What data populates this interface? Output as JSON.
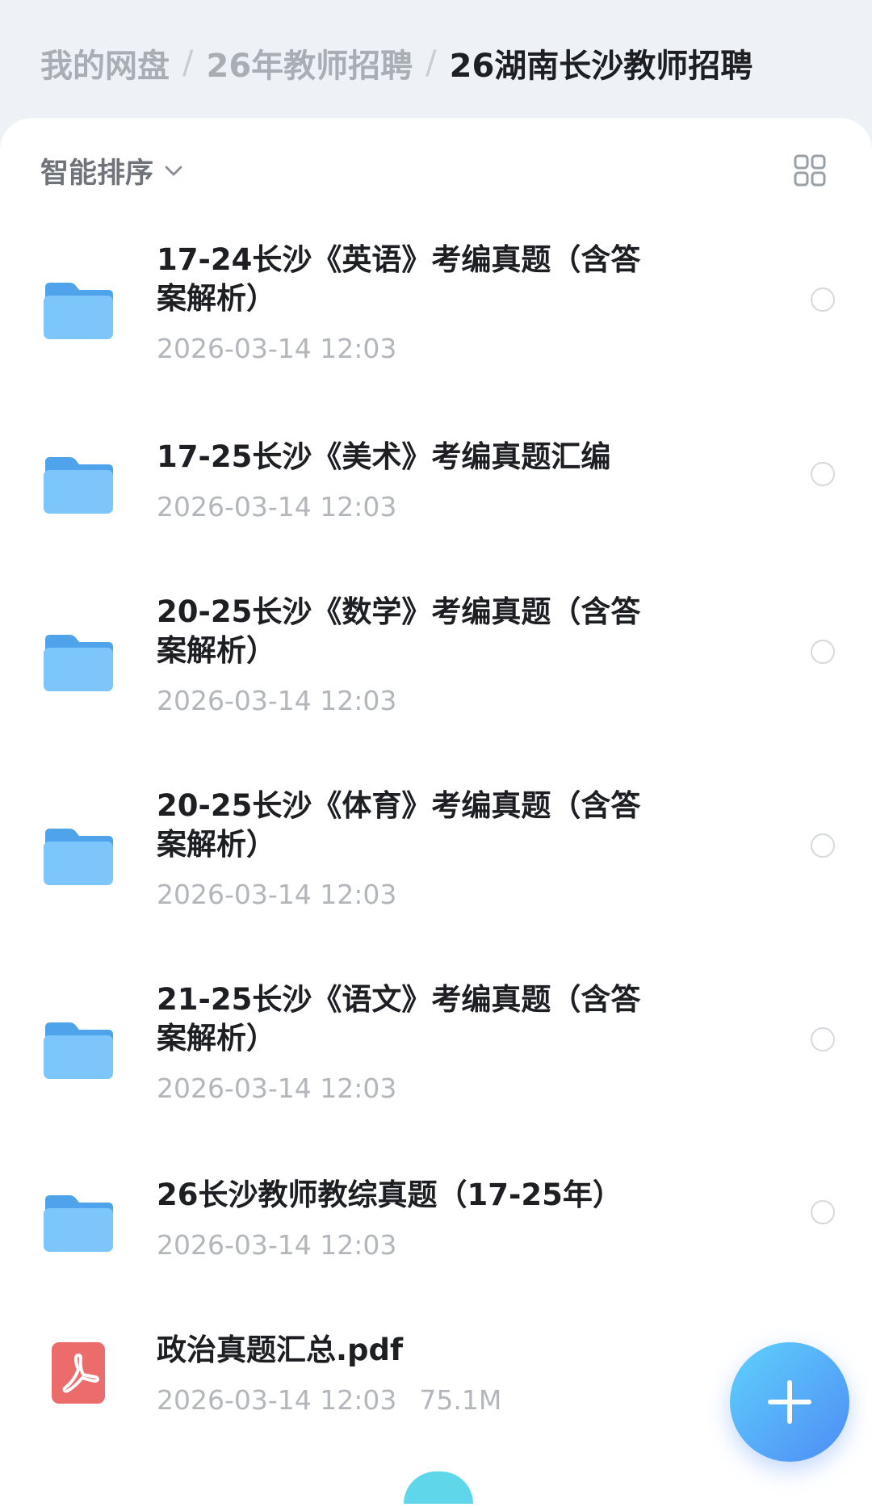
{
  "breadcrumb": {
    "items": [
      "我的网盘",
      "26年教师招聘",
      "26湖南长沙教师招聘"
    ],
    "separator": "/"
  },
  "toolbar": {
    "sort_label": "智能排序"
  },
  "files": [
    {
      "name": "17-24长沙《英语》考编真题（含答案解析）",
      "date": "2026-03-14 12:03",
      "type": "folder"
    },
    {
      "name": "17-25长沙《美术》考编真题汇编",
      "date": "2026-03-14 12:03",
      "type": "folder"
    },
    {
      "name": "20-25长沙《数学》考编真题（含答案解析）",
      "date": "2026-03-14 12:03",
      "type": "folder"
    },
    {
      "name": "20-25长沙《体育》考编真题（含答案解析）",
      "date": "2026-03-14 12:03",
      "type": "folder"
    },
    {
      "name": "21-25长沙《语文》考编真题（含答案解析）",
      "date": "2026-03-14 12:03",
      "type": "folder"
    },
    {
      "name": "26长沙教师教综真题（17-25年）",
      "date": "2026-03-14 12:03",
      "type": "folder"
    },
    {
      "name": "政治真题汇总.pdf",
      "date": "2026-03-14 12:03",
      "size": "75.1M",
      "type": "pdf"
    }
  ],
  "icons": {
    "sort": "chevron-down-icon",
    "view": "grid-view-icon",
    "folder": "folder-icon",
    "pdf": "pdf-file-icon",
    "fab": "plus-icon"
  },
  "colors": {
    "folder": "#63b6f6",
    "pdf": "#ec6b6b",
    "fab_start": "#5ed1fb",
    "fab_end": "#4f8cf6"
  }
}
